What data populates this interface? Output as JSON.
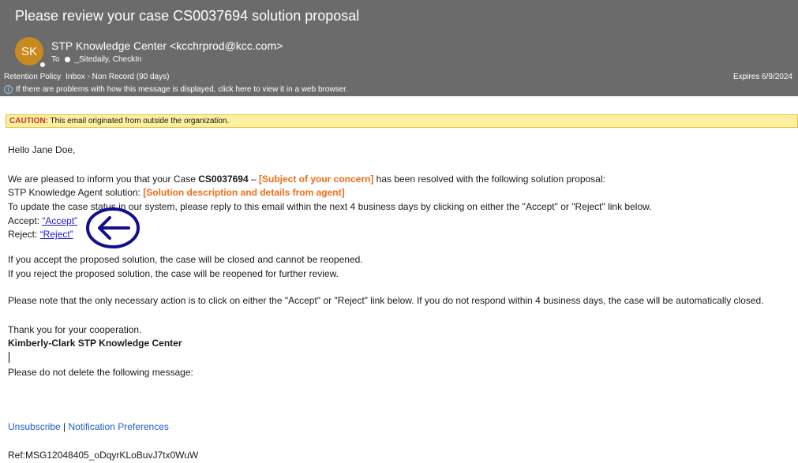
{
  "email": {
    "subject": "Please review your case CS0037694 solution proposal",
    "avatar_initials": "SK",
    "sender": "STP Knowledge Center <kcchrprod@kcc.com>",
    "to_label": "To",
    "to_value": "_Sitedaily, CheckIn",
    "retention_policy": "Retention Policy",
    "retention_value": "Inbox - Non Record (90 days)",
    "expires": "Expires  6/9/2024",
    "info_notice": "If there are problems with how this message is displayed, click here to view it in a web browser."
  },
  "caution": {
    "label": "CAUTION:",
    "text": " This email originated from outside the organization."
  },
  "body": {
    "greeting": "Hello Jane Doe,",
    "p1_a": "We are pleased to inform you that your Case ",
    "p1_case": "CS0037694",
    "p1_b": " – ",
    "p1_subject": "[Subject of your concern]",
    "p1_c": " has been resolved with the following solution proposal:",
    "p2_a": "STP Knowledge Agent solution: ",
    "p2_solution": "[Solution description and details from agent]",
    "p3": "To update the case status in our system, please reply to this email within the next 4 business days by clicking on either the \"Accept\" or \"Reject\" link below.",
    "accept_label": "Accept: ",
    "accept_link": "“Accept”",
    "reject_label": "Reject: ",
    "reject_link": "“Reject”",
    "p4": "If you accept the proposed solution, the case will be closed and cannot be reopened.",
    "p5": "If you reject the proposed solution, the case will be reopened for further review.",
    "p6": "Please note that the only necessary action is to click on either the \"Accept\" or \"Reject\" link below. If you do not respond within 4 business days, the case will be automatically closed.",
    "thanks": "Thank you for your cooperation.",
    "signature": "Kimberly-Clark STP Knowledge Center",
    "do_not_delete": "Please do not delete the following message:",
    "unsubscribe": "Unsubscribe",
    "separator": " | ",
    "notification_prefs": "Notification Preferences",
    "ref": "Ref:MSG12048405_oDqyrKLoBuvJ7tx0WuW"
  },
  "colors": {
    "header_bg": "#6b6b6b",
    "avatar_bg": "#c8891e",
    "caution_bg": "#fcef9f",
    "placeholder_orange": "#ef6c16",
    "link_blue": "#1a1ad8",
    "annotation_navy": "#101090"
  },
  "icons": {
    "annotation": "left-arrow-circle-icon",
    "info": "info-icon",
    "presence": "presence-dot-icon"
  }
}
